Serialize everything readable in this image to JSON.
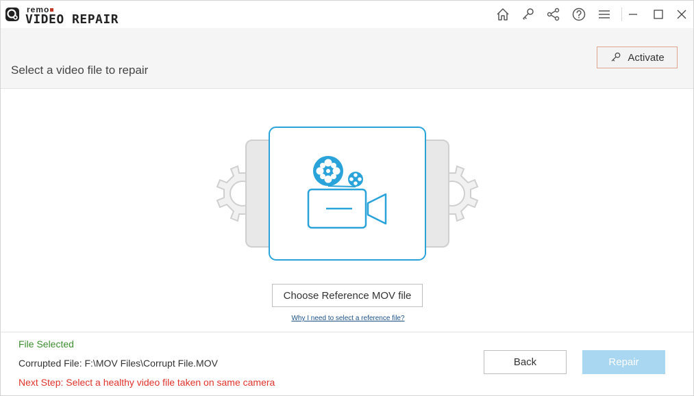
{
  "app": {
    "brand_top": "remo",
    "brand_name": "VIDEO REPAIR"
  },
  "titlebar": {
    "icons": [
      "home-icon",
      "key-icon",
      "share-icon",
      "help-icon",
      "menu-icon",
      "minimize-icon",
      "maximize-icon",
      "close-icon"
    ]
  },
  "header": {
    "title": "Select a video file to repair",
    "activate_label": "Activate"
  },
  "main": {
    "reference_button": "Choose Reference MOV file",
    "reference_help_link": "Why I need to select a reference file?"
  },
  "footer": {
    "status": "File Selected",
    "corrupted_file": "Corrupted File: F:\\MOV Files\\Corrupt File.MOV",
    "next_step": "Next Step: Select a healthy video file taken on same camera",
    "back_label": "Back",
    "repair_label": "Repair"
  },
  "colors": {
    "accent": "#29a3d9",
    "status_ok": "#3c8d2f",
    "status_next": "#e0332b",
    "repair_disabled": "#a9d6f0",
    "activate_border": "#e0a48c"
  }
}
